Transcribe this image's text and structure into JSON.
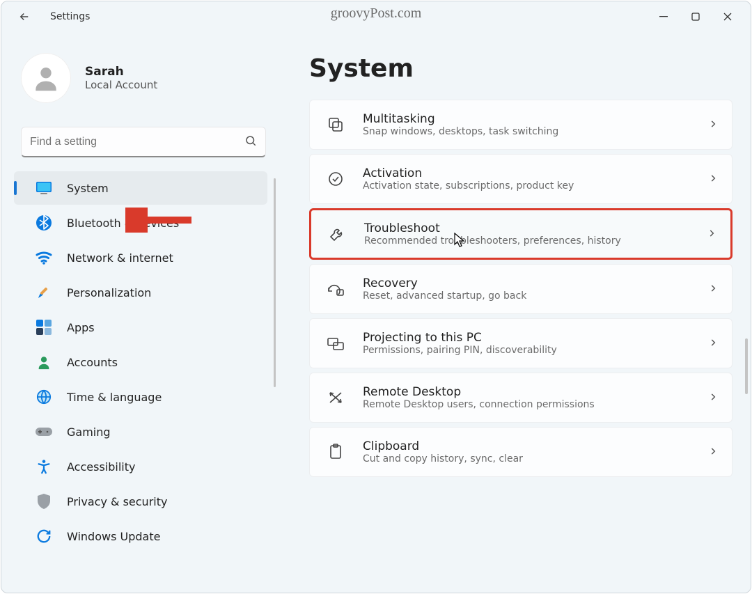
{
  "app": {
    "title": "Settings"
  },
  "watermark": "groovyPost.com",
  "profile": {
    "name": "Sarah",
    "type": "Local Account"
  },
  "search": {
    "placeholder": "Find a setting"
  },
  "sidebar": {
    "items": [
      {
        "id": "system",
        "label": "System",
        "active": true,
        "icon": "system"
      },
      {
        "id": "bluetooth",
        "label": "Bluetooth & devices",
        "icon": "bluetooth"
      },
      {
        "id": "network",
        "label": "Network & internet",
        "icon": "wifi"
      },
      {
        "id": "personalization",
        "label": "Personalization",
        "icon": "brush"
      },
      {
        "id": "apps",
        "label": "Apps",
        "icon": "apps"
      },
      {
        "id": "accounts",
        "label": "Accounts",
        "icon": "person"
      },
      {
        "id": "time",
        "label": "Time & language",
        "icon": "globe"
      },
      {
        "id": "gaming",
        "label": "Gaming",
        "icon": "gamepad"
      },
      {
        "id": "accessibility",
        "label": "Accessibility",
        "icon": "accessibility"
      },
      {
        "id": "privacy",
        "label": "Privacy & security",
        "icon": "shield"
      },
      {
        "id": "update",
        "label": "Windows Update",
        "icon": "update"
      }
    ]
  },
  "page": {
    "title": "System",
    "items": [
      {
        "title": "Multitasking",
        "desc": "Snap windows, desktops, task switching",
        "icon": "multitask"
      },
      {
        "title": "Activation",
        "desc": "Activation state, subscriptions, product key",
        "icon": "check"
      },
      {
        "title": "Troubleshoot",
        "desc": "Recommended troubleshooters, preferences, history",
        "icon": "wrench",
        "highlight": true,
        "cursor": true
      },
      {
        "title": "Recovery",
        "desc": "Reset, advanced startup, go back",
        "icon": "recovery"
      },
      {
        "title": "Projecting to this PC",
        "desc": "Permissions, pairing PIN, discoverability",
        "icon": "project"
      },
      {
        "title": "Remote Desktop",
        "desc": "Remote Desktop users, connection permissions",
        "icon": "remote"
      },
      {
        "title": "Clipboard",
        "desc": "Cut and copy history, sync, clear",
        "icon": "clipboard"
      }
    ]
  },
  "annotation": {
    "arrow_points_to": "sidebar-item-system"
  }
}
